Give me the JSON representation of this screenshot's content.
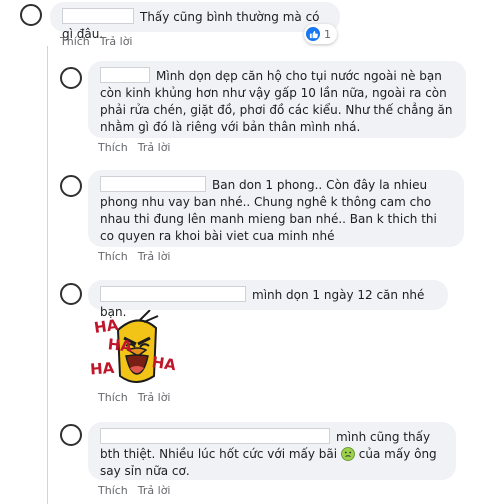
{
  "comments": [
    {
      "text": "Thấy cũng bình thường mà có gì đâu.",
      "reaction_count": "1",
      "actions": {
        "like": "Thích",
        "reply": "Trả lời"
      }
    },
    {
      "text": "Mình dọn dẹp căn hộ cho tụi nước ngoài nè bạn còn kinh khủng hơn như vậy gấp 10 lần nữa, ngoài ra còn phải rửa chén, giặt đồ, phơi đồ các kiểu. Như thế chẳng ăn nhằm gì đó là riêng với bản thân mình nhá.",
      "actions": {
        "like": "Thích",
        "reply": "Trả lời"
      }
    },
    {
      "text": "Ban don 1 phong.. Còn đây la nhieu phong nhu vay ban nhé.. Chung nghê k thông cam cho nhau thi đung lên manh mieng ban nhé.. Ban k thich thi co quyen ra khoi bài viet cua minh nhé",
      "actions": {
        "like": "Thích",
        "reply": "Trả lời"
      }
    },
    {
      "text": "mình dọn 1 ngày 12 căn nhé bạn.",
      "sticker_text": [
        "HA",
        "HA",
        "HA",
        "HA"
      ],
      "actions": {
        "like": "Thích",
        "reply": "Trả lời"
      }
    },
    {
      "text_before": "mình cũng thấy bth thiệt. Nhiều lúc hốt cức với mấy bãi",
      "text_after": "của mấy ông say sỉn nữa cơ.",
      "actions": {
        "like": "Thích",
        "reply": "Trả lời"
      }
    }
  ]
}
